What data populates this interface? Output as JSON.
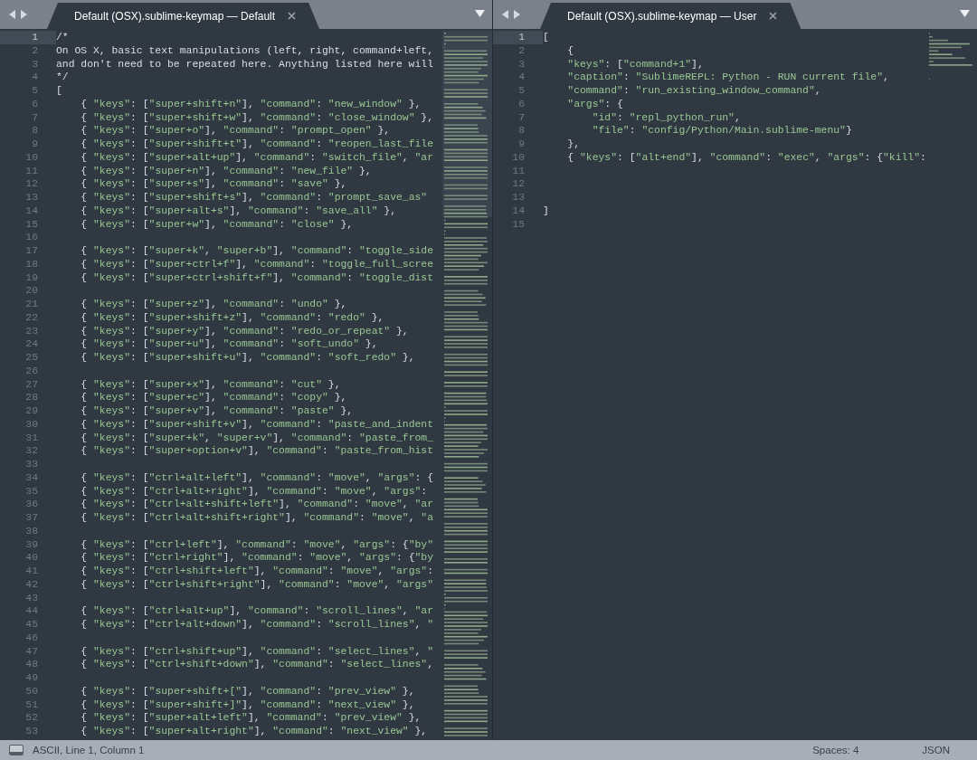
{
  "panes": [
    {
      "tab": {
        "title": "Default (OSX).sublime-keymap — Default",
        "selected": true
      },
      "lines": [
        {
          "number": "1",
          "text": "/*",
          "current": true
        },
        {
          "number": "2",
          "text": "On OS X, basic text manipulations (left, right, command+left,",
          "current": false
        },
        {
          "number": "3",
          "text": "and don't need to be repeated here. Anything listed here will",
          "current": false
        },
        {
          "number": "4",
          "text": "*/",
          "current": false
        },
        {
          "number": "5",
          "text": "[",
          "current": false
        },
        {
          "number": "6",
          "text": "    { \"keys\": [\"super+shift+n\"], \"command\": \"new_window\" },",
          "current": false
        },
        {
          "number": "7",
          "text": "    { \"keys\": [\"super+shift+w\"], \"command\": \"close_window\" },",
          "current": false
        },
        {
          "number": "8",
          "text": "    { \"keys\": [\"super+o\"], \"command\": \"prompt_open\" },",
          "current": false
        },
        {
          "number": "9",
          "text": "    { \"keys\": [\"super+shift+t\"], \"command\": \"reopen_last_file",
          "current": false
        },
        {
          "number": "10",
          "text": "    { \"keys\": [\"super+alt+up\"], \"command\": \"switch_file\", \"ar",
          "current": false
        },
        {
          "number": "11",
          "text": "    { \"keys\": [\"super+n\"], \"command\": \"new_file\" },",
          "current": false
        },
        {
          "number": "12",
          "text": "    { \"keys\": [\"super+s\"], \"command\": \"save\" },",
          "current": false
        },
        {
          "number": "13",
          "text": "    { \"keys\": [\"super+shift+s\"], \"command\": \"prompt_save_as\"",
          "current": false
        },
        {
          "number": "14",
          "text": "    { \"keys\": [\"super+alt+s\"], \"command\": \"save_all\" },",
          "current": false
        },
        {
          "number": "15",
          "text": "    { \"keys\": [\"super+w\"], \"command\": \"close\" },",
          "current": false
        },
        {
          "number": "16",
          "current": false
        },
        {
          "number": "17",
          "text": "    { \"keys\": [\"super+k\", \"super+b\"], \"command\": \"toggle_side",
          "current": false
        },
        {
          "number": "18",
          "text": "    { \"keys\": [\"super+ctrl+f\"], \"command\": \"toggle_full_scree",
          "current": false
        },
        {
          "number": "19",
          "text": "    { \"keys\": [\"super+ctrl+shift+f\"], \"command\": \"toggle_dist",
          "current": false
        },
        {
          "number": "20",
          "current": false
        },
        {
          "number": "21",
          "text": "    { \"keys\": [\"super+z\"], \"command\": \"undo\" },",
          "current": false
        },
        {
          "number": "22",
          "text": "    { \"keys\": [\"super+shift+z\"], \"command\": \"redo\" },",
          "current": false
        },
        {
          "number": "23",
          "text": "    { \"keys\": [\"super+y\"], \"command\": \"redo_or_repeat\" },",
          "current": false
        },
        {
          "number": "24",
          "text": "    { \"keys\": [\"super+u\"], \"command\": \"soft_undo\" },",
          "current": false
        },
        {
          "number": "25",
          "text": "    { \"keys\": [\"super+shift+u\"], \"command\": \"soft_redo\" },",
          "current": false
        },
        {
          "number": "26",
          "current": false
        },
        {
          "number": "27",
          "text": "    { \"keys\": [\"super+x\"], \"command\": \"cut\" },",
          "current": false
        },
        {
          "number": "28",
          "text": "    { \"keys\": [\"super+c\"], \"command\": \"copy\" },",
          "current": false
        },
        {
          "number": "29",
          "text": "    { \"keys\": [\"super+v\"], \"command\": \"paste\" },",
          "current": false
        },
        {
          "number": "30",
          "text": "    { \"keys\": [\"super+shift+v\"], \"command\": \"paste_and_indent",
          "current": false
        },
        {
          "number": "31",
          "text": "    { \"keys\": [\"super+k\", \"super+v\"], \"command\": \"paste_from_",
          "current": false
        },
        {
          "number": "32",
          "text": "    { \"keys\": [\"super+option+v\"], \"command\": \"paste_from_hist",
          "current": false
        },
        {
          "number": "33",
          "current": false
        },
        {
          "number": "34",
          "text": "    { \"keys\": [\"ctrl+alt+left\"], \"command\": \"move\", \"args\": {",
          "current": false
        },
        {
          "number": "35",
          "text": "    { \"keys\": [\"ctrl+alt+right\"], \"command\": \"move\", \"args\":",
          "current": false
        },
        {
          "number": "36",
          "text": "    { \"keys\": [\"ctrl+alt+shift+left\"], \"command\": \"move\", \"ar",
          "current": false
        },
        {
          "number": "37",
          "text": "    { \"keys\": [\"ctrl+alt+shift+right\"], \"command\": \"move\", \"a",
          "current": false
        },
        {
          "number": "38",
          "current": false
        },
        {
          "number": "39",
          "text": "    { \"keys\": [\"ctrl+left\"], \"command\": \"move\", \"args\": {\"by\"",
          "current": false
        },
        {
          "number": "40",
          "text": "    { \"keys\": [\"ctrl+right\"], \"command\": \"move\", \"args\": {\"by",
          "current": false
        },
        {
          "number": "41",
          "text": "    { \"keys\": [\"ctrl+shift+left\"], \"command\": \"move\", \"args\":",
          "current": false
        },
        {
          "number": "42",
          "text": "    { \"keys\": [\"ctrl+shift+right\"], \"command\": \"move\", \"args\"",
          "current": false
        },
        {
          "number": "43",
          "current": false
        },
        {
          "number": "44",
          "text": "    { \"keys\": [\"ctrl+alt+up\"], \"command\": \"scroll_lines\", \"ar",
          "current": false
        },
        {
          "number": "45",
          "text": "    { \"keys\": [\"ctrl+alt+down\"], \"command\": \"scroll_lines\", \"",
          "current": false
        },
        {
          "number": "46",
          "current": false
        },
        {
          "number": "47",
          "text": "    { \"keys\": [\"ctrl+shift+up\"], \"command\": \"select_lines\", \"",
          "current": false
        },
        {
          "number": "48",
          "text": "    { \"keys\": [\"ctrl+shift+down\"], \"command\": \"select_lines\",",
          "current": false
        },
        {
          "number": "49",
          "current": false
        },
        {
          "number": "50",
          "text": "    { \"keys\": [\"super+shift+[\"], \"command\": \"prev_view\" },",
          "current": false
        },
        {
          "number": "51",
          "text": "    { \"keys\": [\"super+shift+]\"], \"command\": \"next_view\" },",
          "current": false
        },
        {
          "number": "52",
          "text": "    { \"keys\": [\"super+alt+left\"], \"command\": \"prev_view\" },",
          "current": false
        },
        {
          "number": "53",
          "text": "    { \"keys\": [\"super+alt+right\"], \"command\": \"next_view\" },",
          "current": false
        }
      ]
    },
    {
      "tab": {
        "title": "Default (OSX).sublime-keymap — User",
        "selected": true
      },
      "lines": [
        {
          "number": "1",
          "text": "[",
          "current": true
        },
        {
          "number": "2",
          "text": "    {",
          "current": false
        },
        {
          "number": "3",
          "text": "    \"keys\": [\"command+1\"],",
          "current": false
        },
        {
          "number": "4",
          "text": "    \"caption\": \"SublimeREPL: Python - RUN current file\",",
          "current": false
        },
        {
          "number": "5",
          "text": "    \"command\": \"run_existing_window_command\",",
          "current": false
        },
        {
          "number": "6",
          "text": "    \"args\": {",
          "current": false
        },
        {
          "number": "7",
          "text": "        \"id\": \"repl_python_run\",",
          "current": false
        },
        {
          "number": "8",
          "text": "        \"file\": \"config/Python/Main.sublime-menu\"}",
          "current": false
        },
        {
          "number": "9",
          "text": "    },",
          "current": false
        },
        {
          "number": "10",
          "text": "    { \"keys\": [\"alt+end\"], \"command\": \"exec\", \"args\": {\"kill\":",
          "current": false
        },
        {
          "number": "11",
          "current": false
        },
        {
          "number": "12",
          "current": false
        },
        {
          "number": "13",
          "current": false
        },
        {
          "number": "14",
          "text": "]",
          "current": false
        },
        {
          "number": "15",
          "current": false
        }
      ]
    }
  ],
  "status_bar": {
    "position": "ASCII, Line 1, Column 1",
    "indentation": "Spaces: 4",
    "syntax": "JSON"
  }
}
